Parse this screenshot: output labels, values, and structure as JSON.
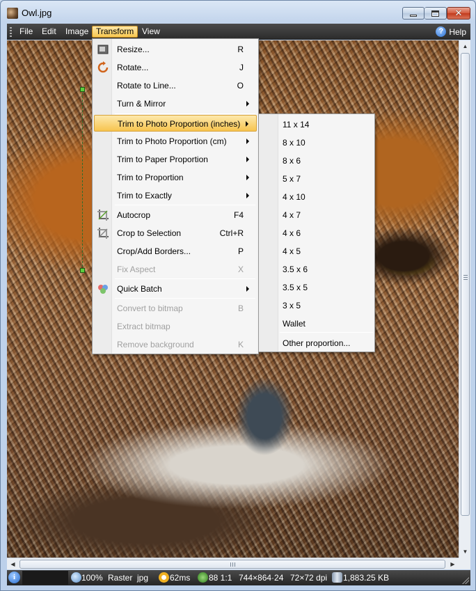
{
  "window": {
    "title": "Owl.jpg"
  },
  "menubar": {
    "items": [
      {
        "label": "File"
      },
      {
        "label": "Edit"
      },
      {
        "label": "Image"
      },
      {
        "label": "Transform"
      },
      {
        "label": "View"
      }
    ],
    "help_label": "Help"
  },
  "transform_menu": {
    "items": [
      {
        "label": "Resize...",
        "shortcut": "R",
        "icon": "resize-icon"
      },
      {
        "label": "Rotate...",
        "shortcut": "J",
        "icon": "rotate-icon"
      },
      {
        "label": "Rotate to Line...",
        "shortcut": "O"
      },
      {
        "label": "Turn & Mirror",
        "shortcut": "",
        "submenu": true
      },
      {
        "label": "Trim to Photo Proportion (inches)",
        "shortcut": "",
        "submenu": true,
        "highlighted": true
      },
      {
        "label": "Trim to Photo Proportion (cm)",
        "shortcut": "",
        "submenu": true
      },
      {
        "label": "Trim to Paper Proportion",
        "shortcut": "",
        "submenu": true
      },
      {
        "label": "Trim to Proportion",
        "shortcut": "",
        "submenu": true
      },
      {
        "label": "Trim to Exactly",
        "shortcut": "",
        "submenu": true
      },
      {
        "label": "Autocrop",
        "shortcut": "F4",
        "icon": "autocrop-icon"
      },
      {
        "label": "Crop to Selection",
        "shortcut": "Ctrl+R",
        "icon": "crop-icon"
      },
      {
        "label": "Crop/Add Borders...",
        "shortcut": "P"
      },
      {
        "label": "Fix Aspect",
        "shortcut": "X",
        "disabled": true
      },
      {
        "label": "Quick Batch",
        "shortcut": "",
        "submenu": true,
        "icon": "batch-icon"
      },
      {
        "label": "Convert to bitmap",
        "shortcut": "B",
        "disabled": true
      },
      {
        "label": "Extract bitmap",
        "shortcut": "",
        "disabled": true
      },
      {
        "label": "Remove background",
        "shortcut": "K",
        "disabled": true
      }
    ]
  },
  "inches_submenu": {
    "items": [
      "11 x 14",
      "8 x 10",
      "8 x 6",
      "5 x 7",
      "4 x 10",
      "4 x 7",
      "4 x 6",
      "4 x 5",
      "3.5 x 6",
      "3.5 x 5",
      "3 x 5",
      "Wallet",
      "Other proportion..."
    ]
  },
  "statusbar": {
    "zoom": "100%",
    "mode": "Raster",
    "format": "jpg",
    "load_time": "62ms",
    "ratio": "88 1:1",
    "dimensions": "744×864·24",
    "dpi": "72×72 dpi",
    "file_size": "1,883.25 KB"
  },
  "colors": {
    "menubar_bg": "#2c2c2c",
    "menu_highlight": "#f7c44f",
    "close_button": "#c23a1c"
  }
}
